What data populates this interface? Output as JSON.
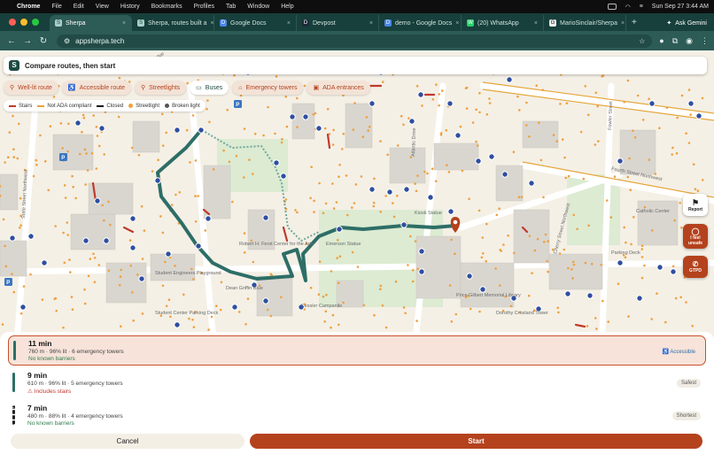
{
  "menubar": {
    "items": [
      "Chrome",
      "File",
      "Edit",
      "View",
      "History",
      "Bookmarks",
      "Profiles",
      "Tab",
      "Window",
      "Help"
    ],
    "clock": "Sun Sep 27  3:44 AM"
  },
  "tabs": [
    {
      "title": "Sherpa",
      "icon": "S"
    },
    {
      "title": "Sherpa, routes built a",
      "icon": "S"
    },
    {
      "title": "Google Docs",
      "icon": "D"
    },
    {
      "title": "Devpost",
      "icon": "D"
    },
    {
      "title": "demo - Google Docs",
      "icon": "D"
    },
    {
      "title": "(20) WhatsApp",
      "icon": "W"
    },
    {
      "title": "MarioSinclair/Sherpa",
      "icon": "G"
    }
  ],
  "browser": {
    "ask": "Ask Gemini",
    "url": "appsherpa.tech"
  },
  "app": {
    "title": "Compare routes, then start",
    "logo": "S"
  },
  "chips": [
    {
      "label": "Well-lit route",
      "icon": "⚲"
    },
    {
      "label": "Accessible route",
      "icon": "♿"
    },
    {
      "label": "Streetlights",
      "icon": "⚲"
    },
    {
      "label": "Buses",
      "icon": "▭"
    },
    {
      "label": "Emergency towers",
      "icon": "⌂"
    },
    {
      "label": "ADA entrances",
      "icon": "▣"
    }
  ],
  "legend": [
    {
      "label": "Stairs",
      "color": "#c0392b",
      "kind": "line"
    },
    {
      "label": "Not ADA compliant",
      "color": "#e8a23a",
      "kind": "line"
    },
    {
      "label": "Closed",
      "color": "#111111",
      "kind": "line"
    },
    {
      "label": "Streetlight",
      "color": "#f0a040",
      "kind": "dot"
    },
    {
      "label": "Broken light",
      "color": "#555555",
      "kind": "dot"
    }
  ],
  "map_labels": {
    "street_4th": "Fourth Street Northwest",
    "street_fowler": "Fowler Street",
    "street_cherry": "Cherry Street Northwest",
    "street_state": "State Street Northwest",
    "street_hemphill": "Hemphill Avenue",
    "street_atlantic": "Atlantic Drive",
    "pl_kessler": "Kessler Campanile",
    "pl_library": "Price Gilbert Memorial Library",
    "pl_crosland": "Dorothy Crosland Tower",
    "pl_dean": "Dean Griffin Blue",
    "pl_student": "Student Center Parking Deck",
    "pl_eng": "Student Engineers Playground",
    "pl_ferst": "Robert H. Ferst Center for the Arts",
    "pl_emerson": "Emerson Statue",
    "pl_kiosk": "Kiosk Statue",
    "pl_catholic": "Catholic Center",
    "pl_parking": "Parking Deck"
  },
  "side_buttons": {
    "report": "Report",
    "unsafe": "I feel unsafe",
    "gtpd": "GTPD"
  },
  "routes": [
    {
      "time": "11 min",
      "meta": "760 m · 96% lit · 6 emergency towers",
      "note": "No known barriers",
      "note_type": "ok",
      "badge": "Accessible",
      "badge_type": "acc",
      "selected": true,
      "line": "solid"
    },
    {
      "time": "9 min",
      "meta": "610 m · 96% lit · 5 emergency towers",
      "note": "Includes stairs",
      "note_type": "warn",
      "badge": "Safest",
      "badge_type": "tag",
      "selected": false,
      "line": "solid"
    },
    {
      "time": "7 min",
      "meta": "480 m · 88% lit · 4 emergency towers",
      "note": "No known barriers",
      "note_type": "ok",
      "badge": "Shortest",
      "badge_type": "tag",
      "selected": false,
      "line": "dots"
    }
  ],
  "actions": {
    "cancel": "Cancel",
    "start": "Start"
  },
  "colors": {
    "route": "#2d6e66",
    "accent": "#b4421d",
    "bus_stop": "#2f4fa0",
    "streetlight": "#f0a040"
  }
}
